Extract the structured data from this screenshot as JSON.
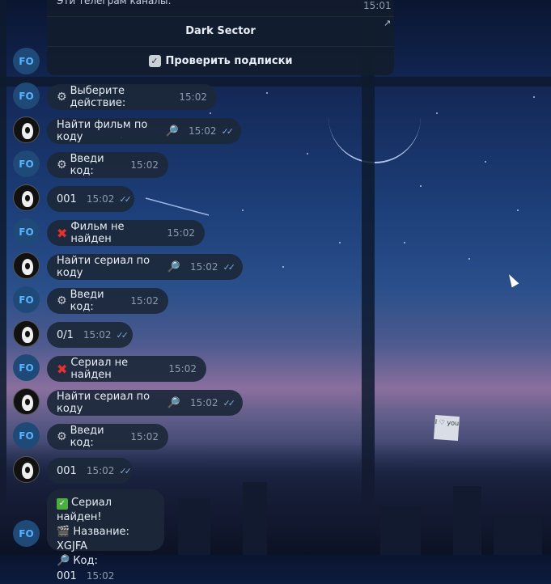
{
  "header": {
    "caption": "Эти телеграм каналы:",
    "time": "15:01",
    "buttons": [
      "Dark Sector",
      "Проверить подписки"
    ]
  },
  "avatars": {
    "bot": "FO"
  },
  "messages": [
    {
      "from": "bot",
      "icon": "gear",
      "text": "Выберите действие:",
      "time": "15:02"
    },
    {
      "from": "user",
      "text": "Найти фильм по коду",
      "icon_after": "magnifier",
      "time": "15:02"
    },
    {
      "from": "bot",
      "icon": "gear",
      "text": "Введи код:",
      "time": "15:02"
    },
    {
      "from": "user",
      "text": "001",
      "time": "15:02"
    },
    {
      "from": "bot",
      "icon": "cross",
      "text": "Фильм не найден",
      "time": "15:02"
    },
    {
      "from": "user",
      "text": "Найти сериал по коду",
      "icon_after": "magnifier",
      "time": "15:02"
    },
    {
      "from": "bot",
      "icon": "gear",
      "text": "Введи код:",
      "time": "15:02"
    },
    {
      "from": "user",
      "text": "0/1",
      "time": "15:02"
    },
    {
      "from": "bot",
      "icon": "cross",
      "text": "Сериал не найден",
      "time": "15:02"
    },
    {
      "from": "user",
      "text": "Найти сериал по коду",
      "icon_after": "magnifier",
      "time": "15:02"
    },
    {
      "from": "bot",
      "icon": "gear",
      "text": "Введи код:",
      "time": "15:02"
    },
    {
      "from": "user",
      "text": "001",
      "time": "15:02"
    }
  ],
  "last_message": {
    "line1": "Сериал найден!",
    "line2": "Название: XGJFA",
    "line3": "Код: 001",
    "time": "15:02"
  },
  "wallpaper_note": "I ♡ you",
  "colors": {
    "accent": "#58b2ff",
    "ticks": "#7aa6d8",
    "cross": "#e5312f",
    "ok": "#4cae3f"
  }
}
